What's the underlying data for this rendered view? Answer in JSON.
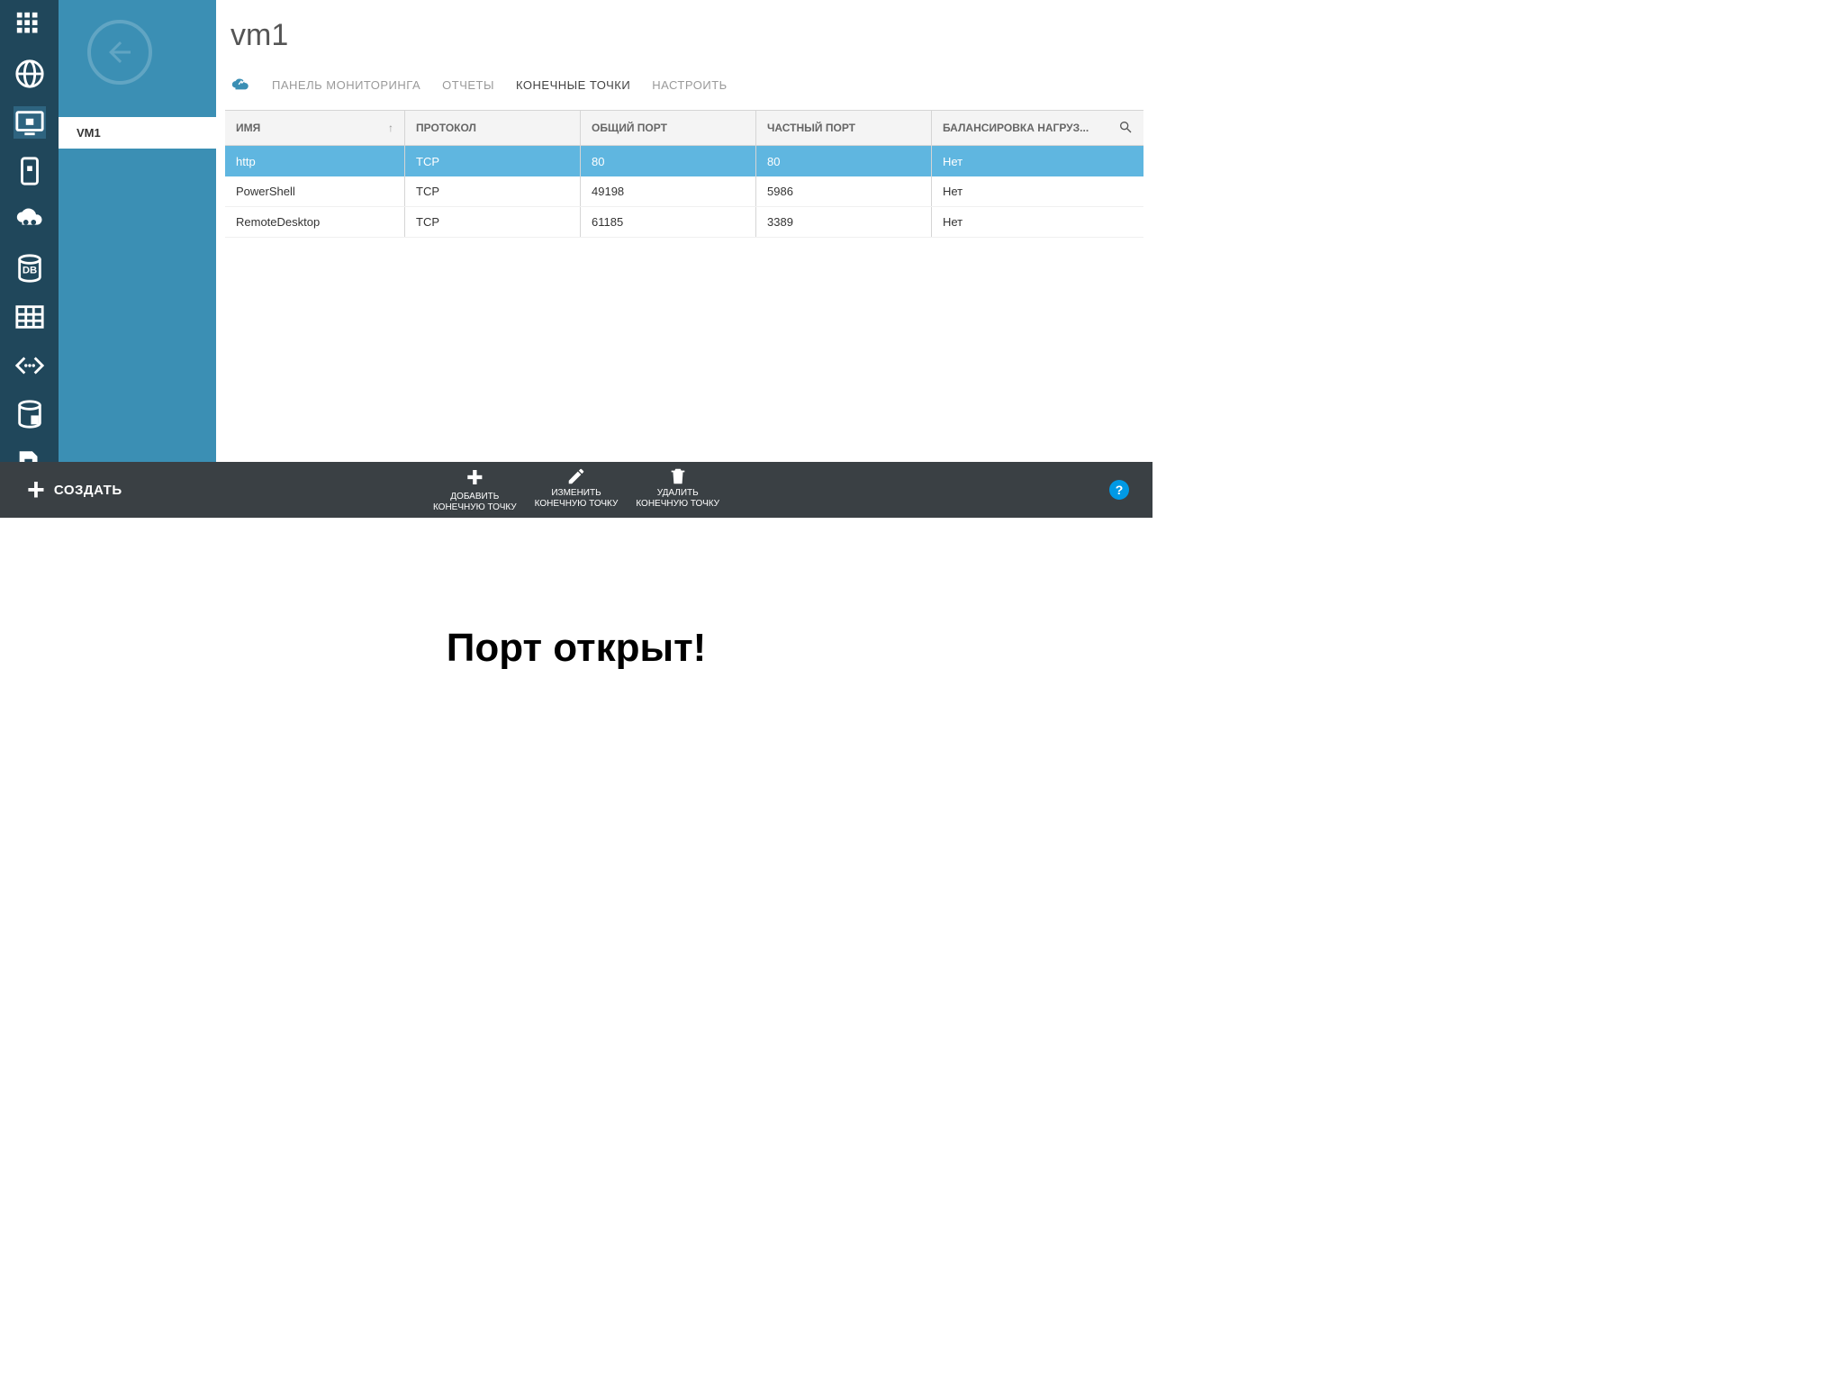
{
  "page_title": "vm1",
  "nav": {
    "items": [
      "VM1"
    ]
  },
  "tabs": {
    "monitoring": "ПАНЕЛЬ МОНИТОРИНГА",
    "reports": "ОТЧЕТЫ",
    "endpoints": "КОНЕЧНЫЕ ТОЧКИ",
    "configure": "НАСТРОИТЬ"
  },
  "table": {
    "headers": {
      "name": "ИМЯ",
      "protocol": "ПРОТОКОЛ",
      "public_port": "ОБЩИЙ ПОРТ",
      "private_port": "ЧАСТНЫЙ ПОРТ",
      "load_balancing": "БАЛАНСИРОВКА НАГРУЗ..."
    },
    "rows": [
      {
        "name": "http",
        "protocol": "TCP",
        "public_port": "80",
        "private_port": "80",
        "lb": "Нет",
        "selected": true
      },
      {
        "name": "PowerShell",
        "protocol": "TCP",
        "public_port": "49198",
        "private_port": "5986",
        "lb": "Нет",
        "selected": false
      },
      {
        "name": "RemoteDesktop",
        "protocol": "TCP",
        "public_port": "61185",
        "private_port": "3389",
        "lb": "Нет",
        "selected": false
      }
    ]
  },
  "bottom": {
    "create": "СОЗДАТЬ",
    "add_line1": "ДОБАВИТЬ",
    "add_line2": "КОНЕЧНУЮ ТОЧКУ",
    "edit_line1": "ИЗМЕНИТЬ",
    "edit_line2": "КОНЕЧНУЮ ТОЧКУ",
    "delete_line1": "УДАЛИТЬ",
    "delete_line2": "КОНЕЧНУЮ ТОЧКУ"
  },
  "caption": "Порт открыт!",
  "icons": {
    "rail": [
      "grid-icon",
      "globe-icon",
      "vm-icon",
      "mobile-icon",
      "cloud-gear-icon",
      "db-icon",
      "table-icon",
      "code-icon",
      "storage-icon",
      "download-icon"
    ]
  }
}
